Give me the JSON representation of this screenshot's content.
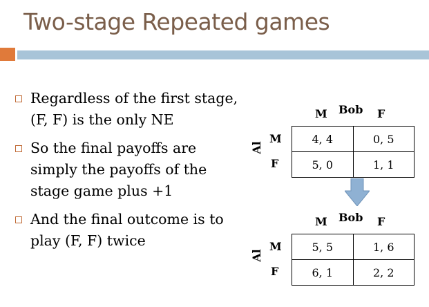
{
  "title": "Two-stage Repeated games",
  "bullets": [
    "Regardless of the first stage, (F, F) is the only NE",
    "So the final payoffs are simply the payoffs of the stage game plus +1",
    "And the final outcome is to play (F, F) twice"
  ],
  "game1": {
    "col_player": "Bob",
    "row_player": "Al",
    "col_labels": [
      "M",
      "F"
    ],
    "row_labels": [
      "M",
      "F"
    ],
    "cells": [
      [
        "4, 4",
        "0, 5"
      ],
      [
        "5, 0",
        "1, 1"
      ]
    ]
  },
  "game2": {
    "col_player": "Bob",
    "row_player": "Al",
    "col_labels": [
      "M",
      "F"
    ],
    "row_labels": [
      "M",
      "F"
    ],
    "cells": [
      [
        "5, 5",
        "1, 6"
      ],
      [
        "6, 1",
        "2, 2"
      ]
    ]
  },
  "colors": {
    "title": "#7a5e4a",
    "accent": "#e07a3a",
    "bar": "#a8c4d8",
    "arrow": "#8fb1d3"
  }
}
